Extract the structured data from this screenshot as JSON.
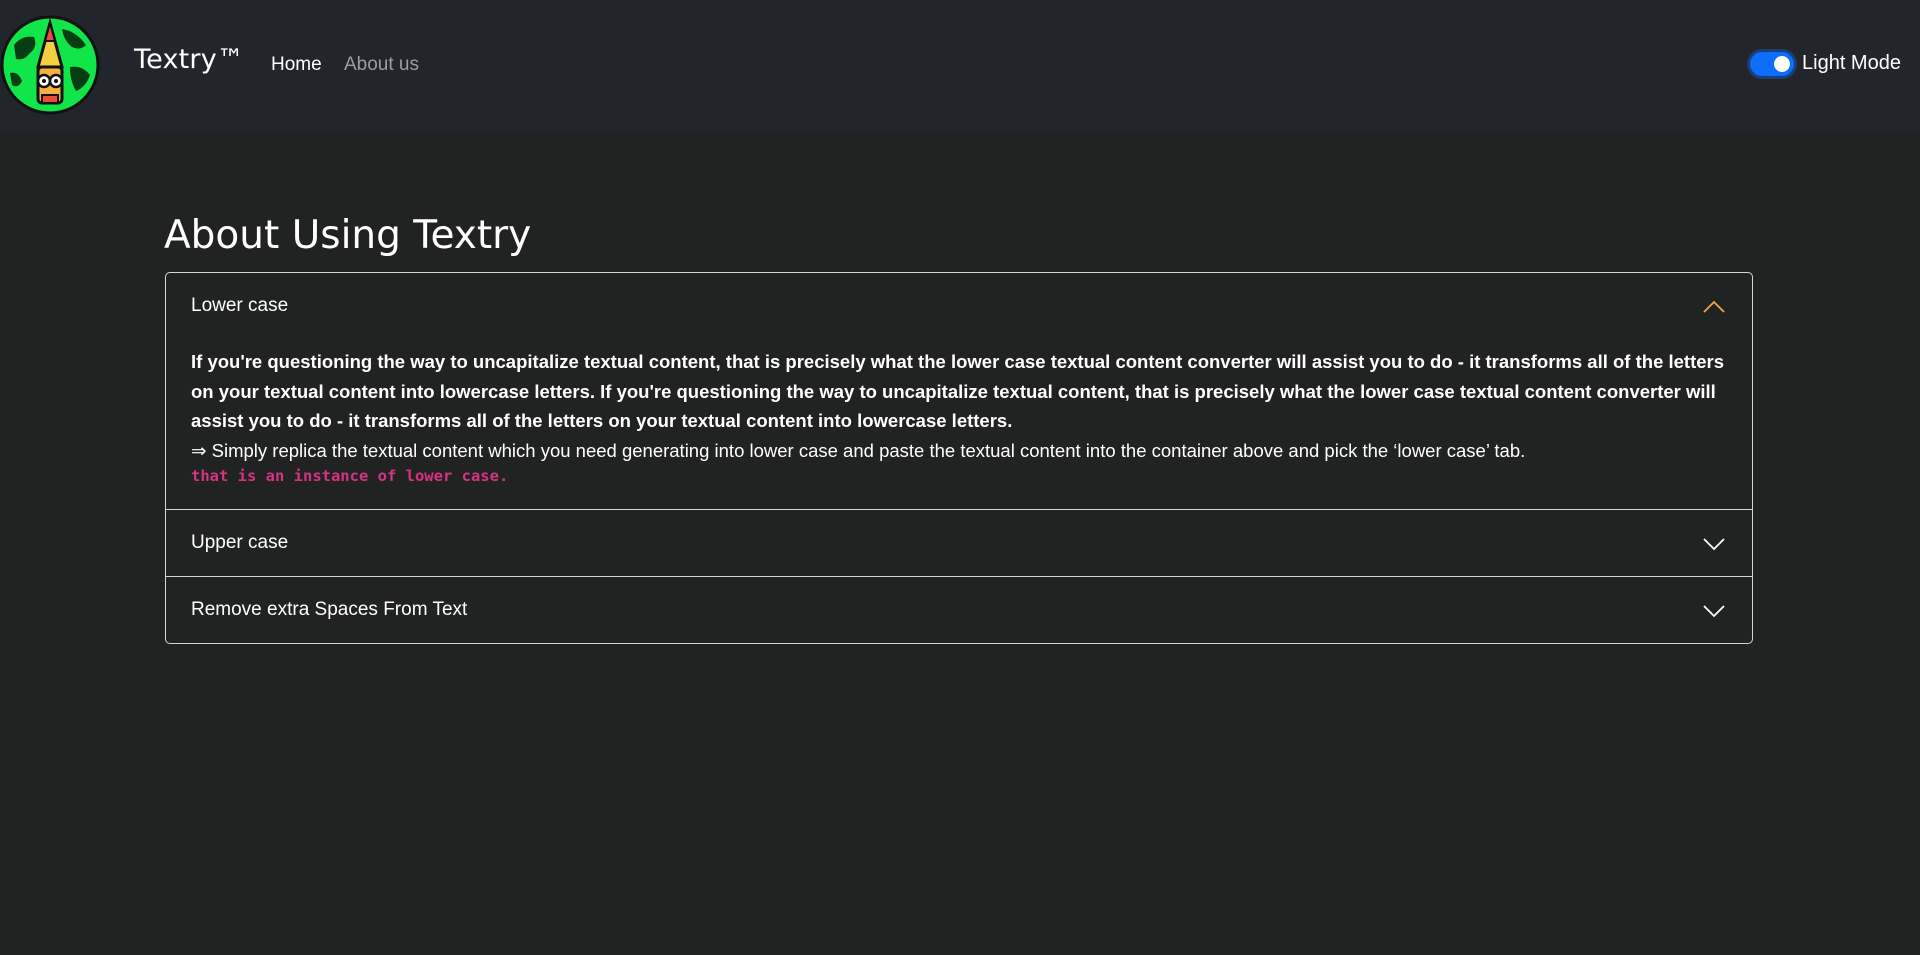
{
  "navbar": {
    "brand": "Textry™",
    "links": [
      {
        "label": "Home"
      },
      {
        "label": "About us"
      }
    ],
    "toggle": {
      "label": "Light Mode",
      "checked": true,
      "color": "#0d6efd"
    }
  },
  "main": {
    "title": "About Using Textry",
    "accordion": [
      {
        "title": "Lower case",
        "expanded": true,
        "body": "If you're questioning the way to uncapitalize textual content, that is precisely what the lower case textual content converter will assist you to do - it transforms all of the letters on your textual content into lowercase letters. If you're questioning the way to uncapitalize textual content, that is precisely what the lower case textual content converter will assist you to do - it transforms all of the letters on your textual content into lowercase letters.",
        "tip": "⇒ Simply replica the textual content which you need generating into lower case and paste the textual content into the container above and pick the ‘lower case’ tab.",
        "example": "that is an instance of lower case.",
        "chevron_icon": "chevron-up-icon",
        "chevron_color": "#f0a64b"
      },
      {
        "title": "Upper case",
        "expanded": false,
        "chevron_icon": "chevron-down-icon"
      },
      {
        "title": "Remove extra Spaces From Text",
        "expanded": false,
        "chevron_icon": "chevron-down-icon"
      }
    ]
  },
  "colors": {
    "page_bg": "#212322",
    "navbar_bg": "#22252c",
    "accent": "#0d6efd",
    "code": "#d63384"
  }
}
